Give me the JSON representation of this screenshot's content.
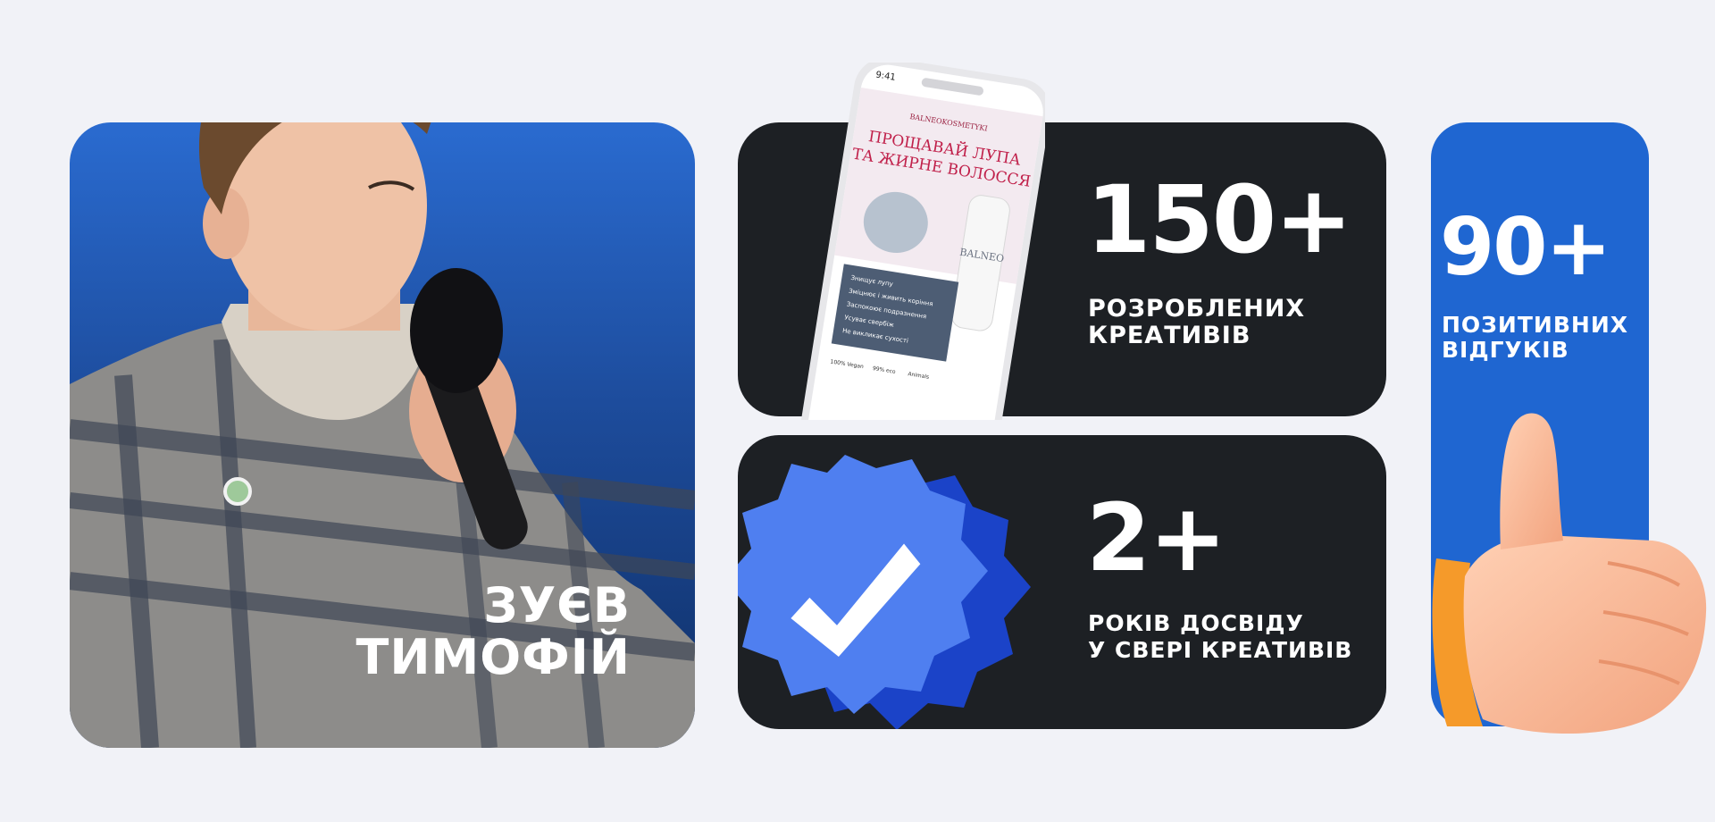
{
  "profile": {
    "name_line1": "ЗУЄВ",
    "name_line2": "ТИМОФІЙ"
  },
  "stats": {
    "creatives": {
      "value": "150+",
      "label_line1": "РОЗРОБЛЕНИХ",
      "label_line2": "КРЕАТИВІВ"
    },
    "experience": {
      "value": "2+",
      "label_line1": "РОКІВ ДОСВІДУ",
      "label_line2": "У СВЕРІ КРЕАТИВІВ"
    },
    "reviews": {
      "value": "90+",
      "label_line1": "ПОЗИТИВНИХ",
      "label_line2": "ВІДГУКІВ"
    }
  },
  "phone_ad": {
    "time": "9:41",
    "brand": "BALNEOKOSMETYKI",
    "headline_line1": "ПРОЩАВАЙ ЛУПА",
    "headline_line2": "ТА ЖИРНЕ ВОЛОССЯ",
    "bullets": [
      "Знищує лупу",
      "Зміцнює і живить коріння",
      "Заспокоює подразнення",
      "Усуває свербіж",
      "Не викликає сухості"
    ],
    "badges": [
      "100% Vegan",
      "99% eco",
      "Animals"
    ],
    "bottle_brand": "BALNEO"
  },
  "colors": {
    "page_bg": "#f1f2f7",
    "card_dark": "#1d2024",
    "accent_blue": "#1f66d1",
    "badge_blue": "#4f7ff0",
    "ad_headline": "#c0204a"
  },
  "icons": [
    "verified-badge-icon",
    "thumbs-up-icon",
    "microphone-icon"
  ]
}
